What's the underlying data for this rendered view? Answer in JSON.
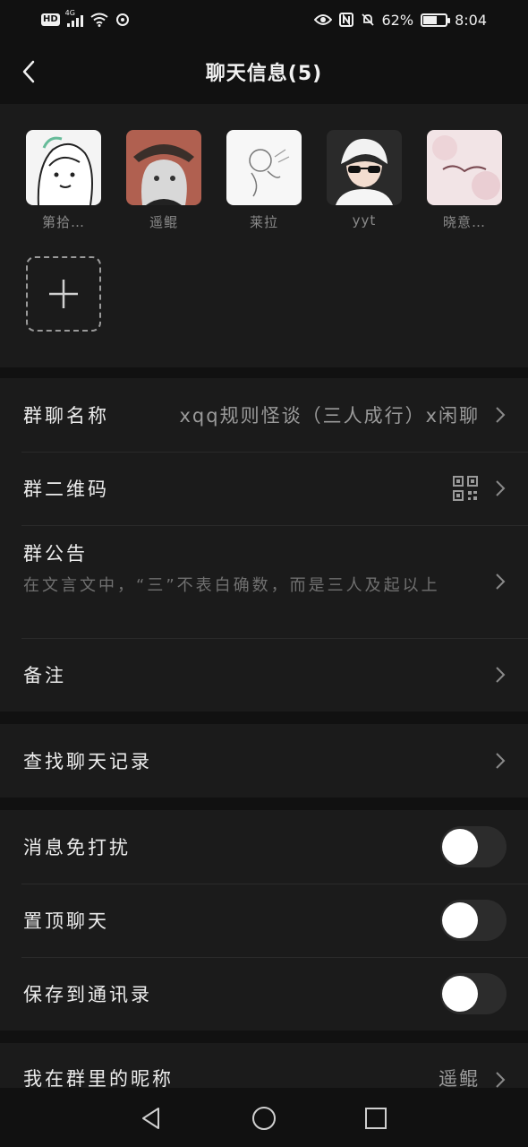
{
  "status_bar": {
    "hd": "HD",
    "network": "4G",
    "battery_percent": "62%",
    "time": "8:04",
    "battery_level": 0.62
  },
  "nav": {
    "title": "聊天信息(5)",
    "back_icon": "chevron-left-icon"
  },
  "members": [
    {
      "name": "第拾…",
      "bg": "#f4f4f4"
    },
    {
      "name": "遥鲲",
      "bg": "#b06050"
    },
    {
      "name": "莱拉",
      "bg": "#f7f7f7"
    },
    {
      "name": "yyt",
      "bg": "#2a2a2a"
    },
    {
      "name": "晓意…",
      "bg": "#f2e4e6"
    }
  ],
  "add_member_icon": "plus-icon",
  "group_name": {
    "label": "群聊名称",
    "value": "xqq规则怪谈（三人成行）x闲聊"
  },
  "qr_code": {
    "label": "群二维码",
    "icon": "qr-code-icon"
  },
  "notice": {
    "label": "群公告",
    "text": "在文言文中，“三”不表白确数，而是三人及起以上"
  },
  "remark": {
    "label": "备注"
  },
  "search_history": {
    "label": "查找聊天记录"
  },
  "toggles": [
    {
      "label": "消息免打扰",
      "on": false
    },
    {
      "label": "置顶聊天",
      "on": false
    },
    {
      "label": "保存到通讯录",
      "on": false
    }
  ],
  "nickname": {
    "label": "我在群里的昵称",
    "value": "遥鲲"
  },
  "colors": {
    "background": "#111111",
    "card": "#1b1b1b",
    "text_primary": "#ececec",
    "text_secondary": "#9a9a9a",
    "toggle_off": "#2c2c2c"
  },
  "system_nav": {
    "back": "triangle-back-icon",
    "home": "circle-home-icon",
    "recents": "square-recents-icon"
  }
}
